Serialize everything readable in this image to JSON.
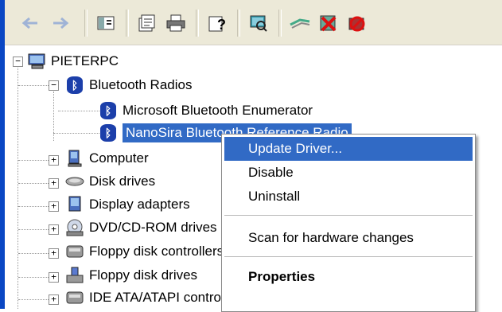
{
  "toolbar": {
    "buttons": [
      {
        "name": "back-icon",
        "glyph": "←"
      },
      {
        "name": "forward-icon",
        "glyph": "→"
      },
      {
        "name": "console-tree-icon",
        "glyph": "▣"
      },
      {
        "name": "properties-icon",
        "glyph": "☰"
      },
      {
        "name": "print-icon",
        "glyph": "⎙"
      },
      {
        "name": "help-icon",
        "glyph": "?"
      },
      {
        "name": "scan-hardware-icon",
        "glyph": "⌕"
      },
      {
        "name": "update-driver-icon",
        "glyph": "≋"
      },
      {
        "name": "uninstall-icon",
        "glyph": "✖"
      },
      {
        "name": "disable-icon",
        "glyph": "⊘"
      }
    ]
  },
  "tree": {
    "root": "PIETERPC",
    "bluetooth_radios": "Bluetooth Radios",
    "bt_enumerator": "Microsoft Bluetooth Enumerator",
    "bt_nanosira": "NanoSira Bluetooth Reference Radio",
    "computer": "Computer",
    "disk_drives": "Disk drives",
    "display_adapters": "Display adapters",
    "dvd": "DVD/CD-ROM drives",
    "floppy_controllers": "Floppy disk controllers",
    "floppy_drives": "Floppy disk drives",
    "ide": "IDE ATA/ATAPI controllers"
  },
  "context_menu": {
    "update_driver": "Update Driver...",
    "disable": "Disable",
    "uninstall": "Uninstall",
    "scan": "Scan for hardware changes",
    "properties": "Properties"
  },
  "colors": {
    "selection": "#316ac5",
    "toolbar_bg": "#ece9d8",
    "window_frame": "#0a47c4"
  }
}
